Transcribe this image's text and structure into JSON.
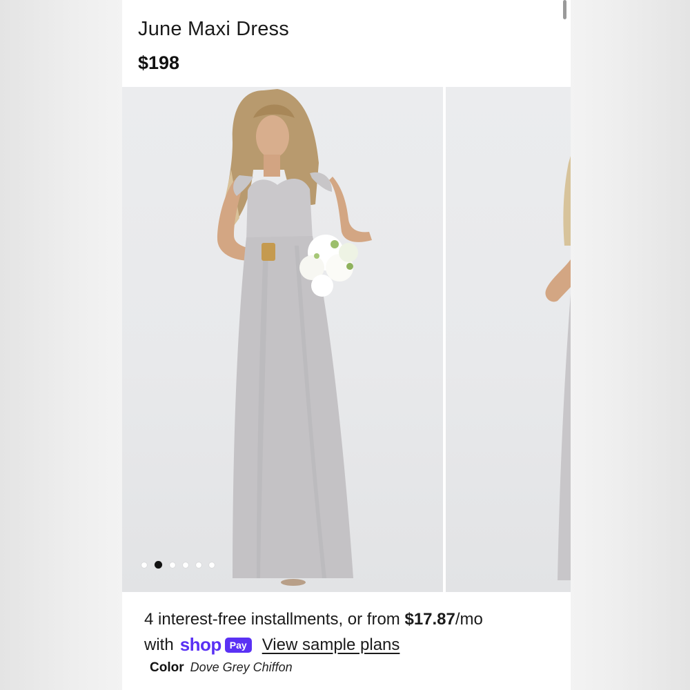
{
  "product": {
    "title": "June Maxi Dress",
    "price": "$198"
  },
  "gallery": {
    "slide_count": 6,
    "active_index": 1
  },
  "payment": {
    "installments_text": "4 interest-free installments, or from ",
    "installment_amount": "$17.87",
    "per_month": "/mo",
    "with_text": "with",
    "shop_logo": "shop",
    "pay_badge": "Pay",
    "sample_link": "View sample plans",
    "brand_color": "#5a31f4"
  },
  "color": {
    "label": "Color",
    "value": "Dove Grey Chiffon"
  }
}
